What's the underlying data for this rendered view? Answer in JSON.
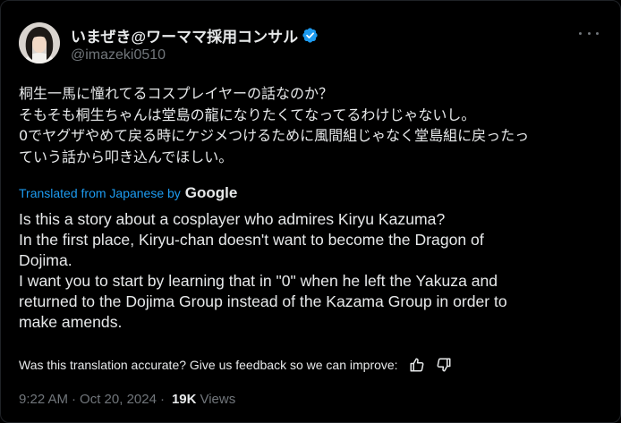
{
  "author": {
    "display_name": "いまぜき@ワーママ採用コンサル",
    "handle": "@imazeki0510",
    "verified": true,
    "verified_color": "#1d9bf0"
  },
  "post": {
    "original_lines": [
      "桐生一馬に憧れてるコスプレイヤーの話なのか？",
      "そもそも桐生ちゃんは堂島の龍になりたくてなってるわけじゃないし。",
      "0でヤグザやめて戻る時にケジメつけるために風間組じゃなく堂島組に戻ったっ",
      "ていう話から叩き込んでほしい。"
    ],
    "translated_by": "Translated from Japanese by",
    "translator": "Google",
    "translation_lines": [
      "Is this a story about a cosplayer who admires Kiryu Kazuma?",
      "In the first place, Kiryu-chan doesn't want to become the Dragon of",
      "Dojima.",
      "I want you to start by learning that in \"0\" when he left the Yakuza and",
      "returned to the Dojima Group instead of the Kazama Group in order to",
      "make amends."
    ],
    "feedback_prompt": "Was this translation accurate? Give us feedback so we can improve:",
    "icons": [
      "thumbs-up-icon",
      "thumbs-down-icon",
      "more-icon",
      "verified-badge-icon"
    ]
  },
  "meta": {
    "time": "9:22 AM",
    "separator": "·",
    "date": "Oct 20, 2024",
    "views_count": "19K",
    "views_label": "Views"
  },
  "colors": {
    "background": "#000000",
    "text": "#e7e9ea",
    "secondary": "#71767b",
    "accent": "#1d9bf0"
  }
}
